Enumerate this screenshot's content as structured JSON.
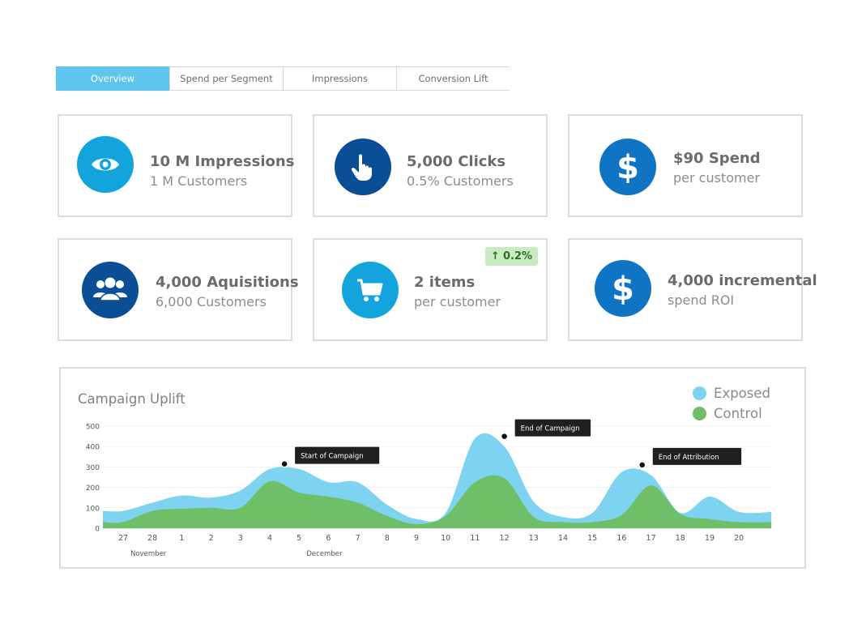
{
  "tabs": [
    {
      "label": "Overview",
      "active": true
    },
    {
      "label": "Spend per Segment",
      "active": false
    },
    {
      "label": "Impressions",
      "active": false
    },
    {
      "label": "Conversion Lift",
      "active": false
    }
  ],
  "cards": [
    {
      "line1": "10 M Impressions",
      "line2": "1 M Customers",
      "icon": "eye-icon",
      "icon_color": "#13a4de"
    },
    {
      "line1": "5,000 Clicks",
      "line2": "0.5% Customers",
      "icon": "hand-pointer-icon",
      "icon_color": "#0a4f96"
    },
    {
      "line1": "$90 Spend",
      "line2": "per customer",
      "icon": "dollar-icon",
      "icon_color": "#0f74c4"
    },
    {
      "line1": "4,000 Aquisitions",
      "line2": "6,000 Customers",
      "icon": "users-group-icon",
      "icon_color": "#0a4f96"
    },
    {
      "line1": "2 items",
      "line2": "per customer",
      "icon": "shopping-cart-icon",
      "icon_color": "#13a4de",
      "badge": "0.2%"
    },
    {
      "line1": "4,000 incremental",
      "line2": "spend ROI",
      "icon": "dollar-icon",
      "icon_color": "#0f74c4"
    }
  ],
  "chart_data": {
    "type": "area",
    "title": "Campaign Uplift",
    "x": [
      "27",
      "28",
      "1",
      "2",
      "3",
      "4",
      "5",
      "6",
      "7",
      "8",
      "9",
      "10",
      "11",
      "12",
      "13",
      "14",
      "15",
      "16",
      "17",
      "18",
      "19",
      "20"
    ],
    "month_labels": [
      {
        "label": "November",
        "at": "28"
      },
      {
        "label": "December",
        "at": "6"
      }
    ],
    "ylim": [
      0,
      500
    ],
    "yticks": [
      0,
      100,
      200,
      300,
      400,
      500
    ],
    "series": [
      {
        "name": "Exposed",
        "color": "#7dd3f0",
        "values": [
          85,
          125,
          160,
          150,
          185,
          290,
          290,
          225,
          225,
          115,
          45,
          75,
          440,
          400,
          130,
          55,
          75,
          275,
          260,
          75,
          155,
          80
        ]
      },
      {
        "name": "Control",
        "color": "#6fbe68",
        "values": [
          30,
          85,
          95,
          100,
          100,
          230,
          175,
          155,
          125,
          60,
          20,
          60,
          225,
          245,
          55,
          30,
          30,
          65,
          210,
          70,
          45,
          30
        ]
      }
    ],
    "annotations": [
      {
        "label": "Start of Campaign",
        "x": "4.5",
        "y": 315
      },
      {
        "label": "End of Campaign",
        "x": "12",
        "y": 450
      },
      {
        "label": "End of Attribution",
        "x": "16.7",
        "y": 310
      }
    ]
  }
}
